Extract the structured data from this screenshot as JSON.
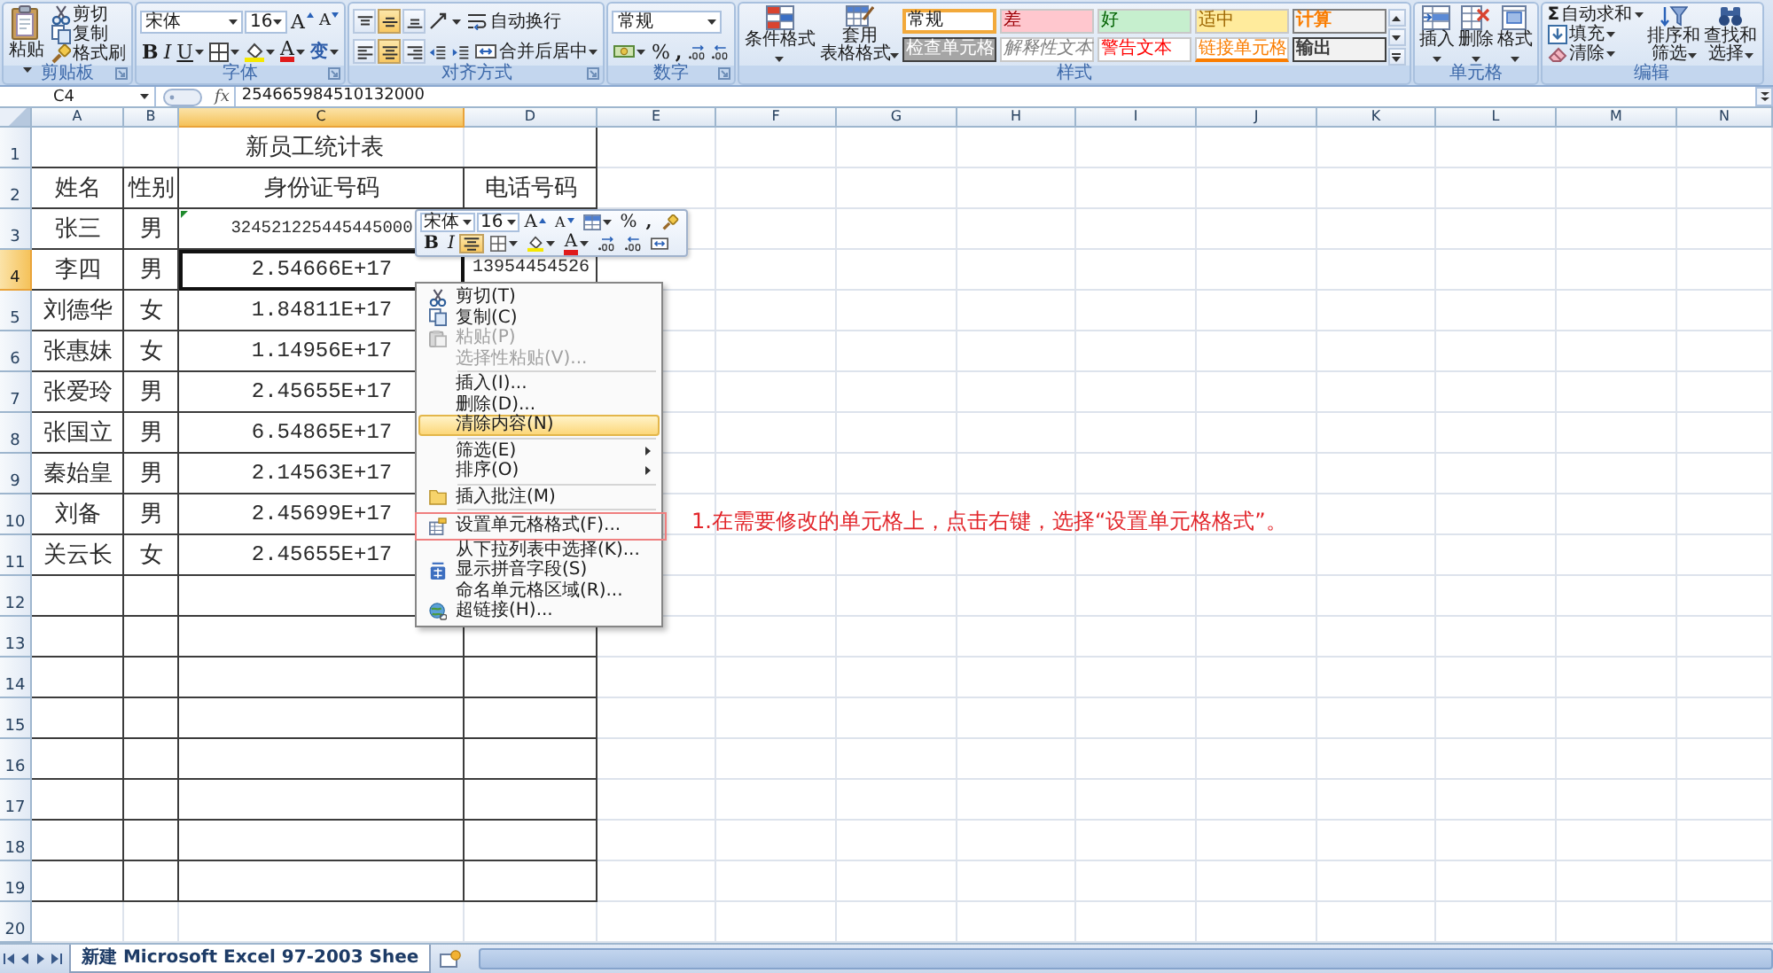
{
  "ribbon": {
    "clipboard": {
      "label": "剪贴板",
      "paste": "粘贴",
      "cut": "剪切",
      "copy": "复制",
      "format_painter": "格式刷"
    },
    "font": {
      "label": "字体",
      "font_name": "宋体",
      "font_size": "16",
      "grow": "A",
      "shrink": "A",
      "bold": "B",
      "italic": "I",
      "underline": "U",
      "font_color": "A",
      "phonetic": "变"
    },
    "alignment": {
      "label": "对齐方式",
      "vertical": [
        {
          "kind": "top",
          "selected": false
        },
        {
          "kind": "middle",
          "selected": true
        },
        {
          "kind": "bottom",
          "selected": false
        }
      ],
      "wrap_text": "自动换行",
      "horizontal": [
        {
          "kind": "left",
          "selected": false
        },
        {
          "kind": "center",
          "selected": true
        },
        {
          "kind": "right",
          "selected": false
        }
      ],
      "merge_center": "合并后居中"
    },
    "number": {
      "label": "数字",
      "format": "常规",
      "percent": "%",
      "comma": ","
    },
    "styles": {
      "label": "样式",
      "conditional": "条件格式",
      "table_format": [
        "套用",
        "表格格式"
      ],
      "cell_styles": [
        {
          "text": "常规",
          "kind": "normal",
          "selected": true
        },
        {
          "text": "差",
          "kind": "bad",
          "selected": false
        },
        {
          "text": "好",
          "kind": "good",
          "selected": false
        },
        {
          "text": "适中",
          "kind": "neutral",
          "selected": false
        },
        {
          "text": "计算",
          "kind": "calculation",
          "selected": false
        },
        {
          "text": "检查单元格",
          "kind": "check",
          "selected": false
        },
        {
          "text": "解释性文本",
          "kind": "explanatory",
          "selected": false
        },
        {
          "text": "警告文本",
          "kind": "warning",
          "selected": false
        },
        {
          "text": "链接单元格",
          "kind": "linked",
          "selected": false
        },
        {
          "text": "输出",
          "kind": "output",
          "selected": false
        }
      ]
    },
    "cells": {
      "label": "单元格",
      "insert": "插入",
      "delete": "删除",
      "format": "格式"
    },
    "editing": {
      "label": "编辑",
      "sum_sign": "Σ",
      "autosum": "自动求和",
      "fill": "填充",
      "clear": "清除",
      "sort_filter": [
        "排序和",
        "筛选"
      ],
      "find_select": [
        "查找和",
        "选择"
      ]
    }
  },
  "formula_bar": {
    "name_box": "C4",
    "fx": "fx",
    "value": "254665984510132000"
  },
  "sheet": {
    "columns": [
      {
        "letter": "A",
        "selected": false
      },
      {
        "letter": "B",
        "selected": false
      },
      {
        "letter": "C",
        "selected": true
      },
      {
        "letter": "D",
        "selected": false
      },
      {
        "letter": "E",
        "selected": false
      },
      {
        "letter": "F",
        "selected": false
      },
      {
        "letter": "G",
        "selected": false
      },
      {
        "letter": "H",
        "selected": false
      },
      {
        "letter": "I",
        "selected": false
      },
      {
        "letter": "J",
        "selected": false
      },
      {
        "letter": "K",
        "selected": false
      },
      {
        "letter": "L",
        "selected": false
      },
      {
        "letter": "M",
        "selected": false
      },
      {
        "letter": "N",
        "selected": false
      }
    ],
    "rows": [
      {
        "number": "1",
        "selected": false
      },
      {
        "number": "2",
        "selected": false
      },
      {
        "number": "3",
        "selected": false
      },
      {
        "number": "4",
        "selected": true
      },
      {
        "number": "5",
        "selected": false
      },
      {
        "number": "6",
        "selected": false
      },
      {
        "number": "7",
        "selected": false
      },
      {
        "number": "8",
        "selected": false
      },
      {
        "number": "9",
        "selected": false
      },
      {
        "number": "10",
        "selected": false
      },
      {
        "number": "11",
        "selected": false
      },
      {
        "number": "12",
        "selected": false
      },
      {
        "number": "13",
        "selected": false
      },
      {
        "number": "14",
        "selected": false
      },
      {
        "number": "15",
        "selected": false
      },
      {
        "number": "16",
        "selected": false
      },
      {
        "number": "17",
        "selected": false
      },
      {
        "number": "18",
        "selected": false
      },
      {
        "number": "19",
        "selected": false
      },
      {
        "number": "20",
        "selected": false
      }
    ],
    "title": "新员工统计表",
    "headers": [
      "姓名",
      "性别",
      "身份证号码",
      "电话号码"
    ],
    "records": [
      {
        "name": "张三",
        "gender": "男",
        "id": "324521225445445000",
        "flagged": true,
        "id_selected": false
      },
      {
        "name": "李四",
        "gender": "男",
        "id": "2.54666E+17",
        "phone": "13954454526",
        "flagged": false,
        "id_selected": true
      },
      {
        "name": "刘德华",
        "gender": "女",
        "id": "1.84811E+17",
        "flagged": false,
        "id_selected": false
      },
      {
        "name": "张惠妹",
        "gender": "女",
        "id": "1.14956E+17",
        "flagged": false,
        "id_selected": false
      },
      {
        "name": "张爱玲",
        "gender": "男",
        "id": "2.45655E+17",
        "flagged": false,
        "id_selected": false
      },
      {
        "name": "张国立",
        "gender": "男",
        "id": "6.54865E+17",
        "flagged": false,
        "id_selected": false
      },
      {
        "name": "秦始皇",
        "gender": "男",
        "id": "2.14563E+17",
        "flagged": false,
        "id_selected": false
      },
      {
        "name": "刘备",
        "gender": "男",
        "id": "2.45699E+17",
        "flagged": false,
        "id_selected": false
      },
      {
        "name": "关云长",
        "gender": "女",
        "id": "2.45655E+17",
        "flagged": false,
        "id_selected": false
      }
    ]
  },
  "mini_toolbar": {
    "font_name": "宋体",
    "font_size": "16",
    "grow": "A",
    "shrink": "A",
    "percent": "%",
    "comma": ",",
    "bold": "B",
    "italic": "I",
    "center_selected": true,
    "font_color": "A"
  },
  "context_menu": {
    "groups": [
      [
        {
          "label": "剪切(T)",
          "kind": "cut",
          "disabled": false,
          "selected": false,
          "submenu": false,
          "marked": false
        },
        {
          "label": "复制(C)",
          "kind": "copy",
          "disabled": false,
          "selected": false,
          "submenu": false,
          "marked": false
        },
        {
          "label": "粘贴(P)",
          "kind": "paste",
          "disabled": true,
          "selected": false,
          "submenu": false,
          "marked": false
        },
        {
          "label": "选择性粘贴(V)...",
          "kind": "plain",
          "disabled": true,
          "selected": false,
          "submenu": false,
          "marked": false
        }
      ],
      [
        {
          "label": "插入(I)...",
          "kind": "plain",
          "disabled": false,
          "selected": false,
          "submenu": false,
          "marked": false
        },
        {
          "label": "删除(D)...",
          "kind": "plain",
          "disabled": false,
          "selected": false,
          "submenu": false,
          "marked": false
        },
        {
          "label": "清除内容(N)",
          "kind": "plain",
          "disabled": false,
          "selected": true,
          "submenu": false,
          "marked": false
        }
      ],
      [
        {
          "label": "筛选(E)",
          "kind": "plain",
          "disabled": false,
          "selected": false,
          "submenu": true,
          "marked": false
        },
        {
          "label": "排序(O)",
          "kind": "plain",
          "disabled": false,
          "selected": false,
          "submenu": true,
          "marked": false
        }
      ],
      [
        {
          "label": "插入批注(M)",
          "kind": "comment",
          "disabled": false,
          "selected": false,
          "submenu": false,
          "marked": false
        }
      ],
      [
        {
          "label": "设置单元格格式(F)...",
          "kind": "format",
          "disabled": false,
          "selected": false,
          "submenu": false,
          "marked": true
        },
        {
          "label": "从下拉列表中选择(K)...",
          "kind": "plain",
          "disabled": false,
          "selected": false,
          "submenu": false,
          "marked": false
        },
        {
          "label": "显示拼音字段(S)",
          "kind": "phonetic",
          "disabled": false,
          "selected": false,
          "submenu": false,
          "marked": false
        },
        {
          "label": "命名单元格区域(R)...",
          "kind": "plain",
          "disabled": false,
          "selected": false,
          "submenu": false,
          "marked": false
        },
        {
          "label": "超链接(H)...",
          "kind": "link",
          "disabled": false,
          "selected": false,
          "submenu": false,
          "marked": false
        }
      ]
    ]
  },
  "annotation": {
    "text": "1.在需要修改的单元格上，点击右键，选择“设置单元格格式”。"
  },
  "sheet_tabs": [
    {
      "label": "新建 Microsoft Excel 97-2003 Shee",
      "selected": true
    }
  ]
}
